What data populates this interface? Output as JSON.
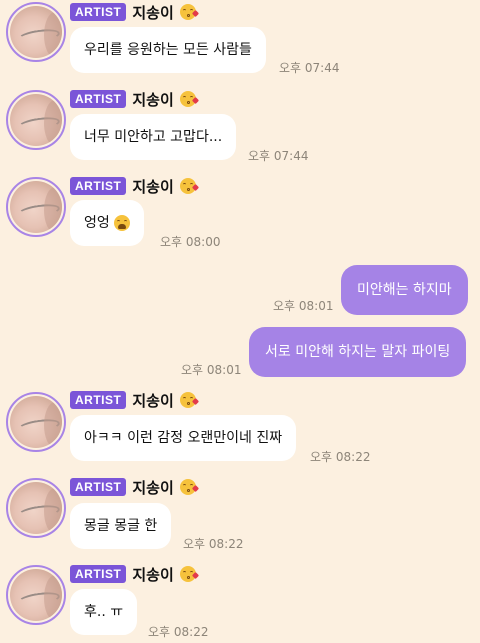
{
  "artist": {
    "badge": "ARTIST",
    "name": "지송이"
  },
  "messages": [
    {
      "text": "우리를 응원하는 모든 사람들",
      "time": "오후 07:44"
    },
    {
      "text": "너무 미안하고 고맙다...",
      "time": "오후 07:44"
    },
    {
      "text": "엉엉",
      "time": "오후 08:00"
    },
    {
      "text": "미안해는 하지마",
      "time": "오후 08:01"
    },
    {
      "text": "서로 미안해 하지는 말자 파이팅",
      "time": "오후 08:01"
    },
    {
      "text": "아ㅋㅋ 이런 감정 오랜만이네 진짜",
      "time": "오후 08:22"
    },
    {
      "text": "몽글 몽글 한",
      "time": "오후 08:22"
    },
    {
      "text": "후.. ㅠ",
      "time": "오후 08:22"
    }
  ],
  "icons": {
    "name_emoji": "kissing-face-icon",
    "message_emoji": "weary-face-icon"
  },
  "colors": {
    "background": "#fcf0e0",
    "badge": "#7b55d8",
    "outgoing_bubble": "#a583e6",
    "avatar_ring": "#a884e6"
  }
}
